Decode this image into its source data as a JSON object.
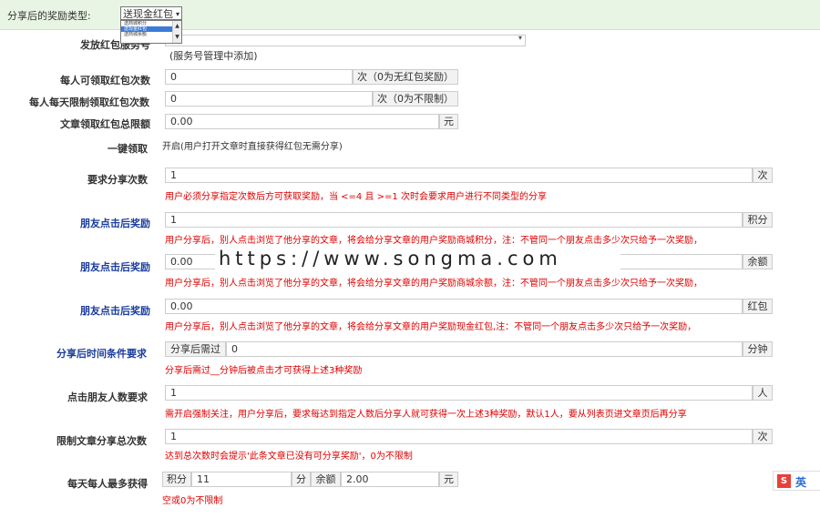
{
  "top": {
    "label": "分享后的奖励类型:",
    "select_value": "送现金红包",
    "options": [
      "送商城积分",
      "送现金红包",
      "送商城余额"
    ],
    "selected_index": 1
  },
  "rows": {
    "send_account": {
      "label": "发放红包服务号",
      "note": "(服务号管理中添加)"
    },
    "per_person": {
      "label": "每人可领取红包次数",
      "value": "0",
      "unit": "次（0为无红包奖励）"
    },
    "per_day": {
      "label": "每人每天限制领取红包次数",
      "value": "0",
      "unit": "次（0为不限制）"
    },
    "total_limit": {
      "label": "文章领取红包总限额",
      "value": "0.00",
      "unit": "元"
    },
    "one_click": {
      "label": "一键领取",
      "note": "开启(用户打开文章时直接获得红包无需分享)"
    },
    "share_times": {
      "label": "要求分享次数",
      "value": "1",
      "unit": "次",
      "hint": "用户必须分享指定次数后方可获取奖励，当 <=4 且 >=1 次时会要求用户进行不同类型的分享"
    },
    "click_points": {
      "label": "朋友点击后奖励",
      "value": "1",
      "unit": "积分",
      "hint": "用户分享后，别人点击浏览了他分享的文章，将会给分享文章的用户奖励商城积分，注：不管同一个朋友点击多少次只给予一次奖励，"
    },
    "click_balance": {
      "label": "朋友点击后奖励",
      "value": "0.00",
      "unit": "余额",
      "hint": "用户分享后，别人点击浏览了他分享的文章，将会给分享文章的用户奖励商城余额，注：不管同一个朋友点击多少次只给予一次奖励，"
    },
    "click_redpack": {
      "label": "朋友点击后奖励",
      "value": "0.00",
      "unit": "红包",
      "hint": "用户分享后，别人点击浏览了他分享的文章，将会给分享文章的用户奖励现金红包,注：不管同一个朋友点击多少次只给予一次奖励，"
    },
    "time_cond": {
      "label": "分享后时间条件要求",
      "prefix": "分享后需过",
      "value": "0",
      "unit": "分钟",
      "hint": "分享后需过__分钟后被点击才可获得上述3种奖励"
    },
    "friend_count": {
      "label": "点击朋友人数要求",
      "value": "1",
      "unit": "人",
      "hint": "需开启强制关注，用户分享后，要求每达到指定人数后分享人就可获得一次上述3种奖励，默认1人，要从列表页进文章页后再分享"
    },
    "share_total": {
      "label": "限制文章分享总次数",
      "value": "1",
      "unit": "次",
      "hint": "达到总次数时会提示'此条文章已没有可分享奖励'，0为不限制"
    },
    "daily_max": {
      "label": "每天每人最多获得",
      "points_label": "积分",
      "points_value": "11",
      "points_unit": "分",
      "balance_label": "余额",
      "balance_value": "2.00",
      "balance_unit": "元",
      "hint": "空或0为不限制"
    }
  },
  "watermark": "https://www.songma.com",
  "ime": {
    "icon": "S",
    "text": "英"
  }
}
